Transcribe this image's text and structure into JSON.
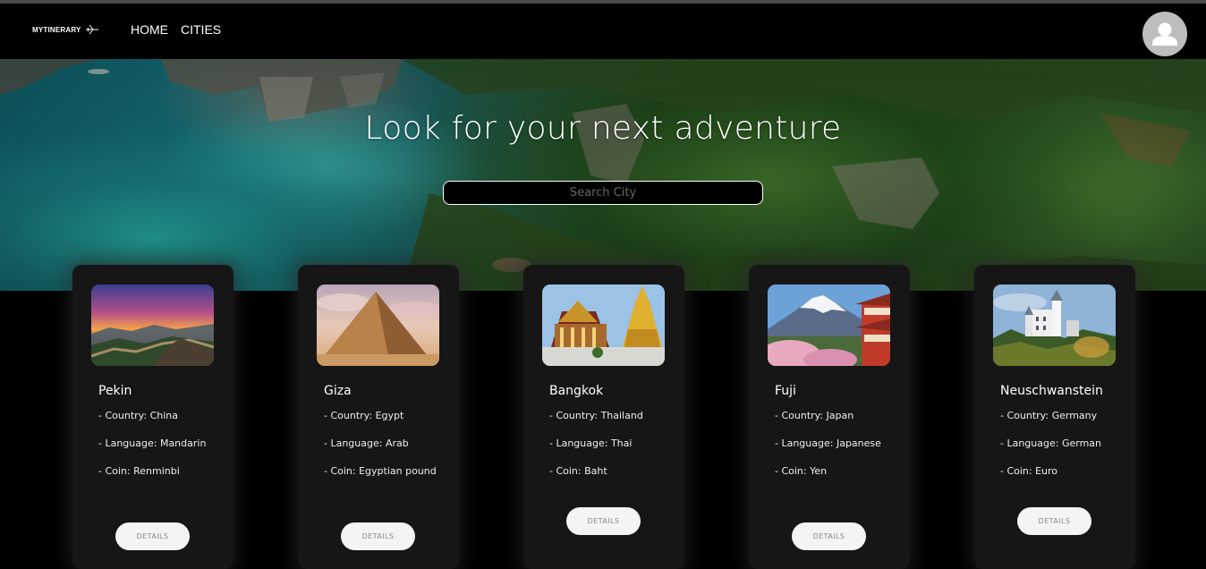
{
  "nav": {
    "brand": "MYTINERARY",
    "links": [
      {
        "label": "HOME"
      },
      {
        "label": "CITIES"
      }
    ]
  },
  "hero": {
    "title": "Look for your next adventure",
    "search_placeholder": "Search City"
  },
  "cards": [
    {
      "city": "Pekin",
      "country": "- Country: China",
      "language": "- Language: Mandarin",
      "coin": "- Coin: Renminbi",
      "button": "DETAILS",
      "image": "great-wall-sunset"
    },
    {
      "city": "Giza",
      "country": "- Country: Egypt",
      "language": "- Language: Arab",
      "coin": "- Coin: Egyptian pound",
      "button": "DETAILS",
      "image": "pyramid"
    },
    {
      "city": "Bangkok",
      "country": "- Country: Thailand",
      "language": "- Language: Thai",
      "coin": "- Coin: Baht",
      "button": "DETAILS",
      "image": "temple"
    },
    {
      "city": "Fuji",
      "country": "- Country: Japan",
      "language": "- Language: Japanese",
      "coin": "- Coin: Yen",
      "button": "DETAILS",
      "image": "mount-fuji-pagoda"
    },
    {
      "city": "Neuschwanstein",
      "country": "- Country: Germany",
      "language": "- Language: German",
      "coin": "- Coin: Euro",
      "button": "DETAILS",
      "image": "castle"
    }
  ]
}
